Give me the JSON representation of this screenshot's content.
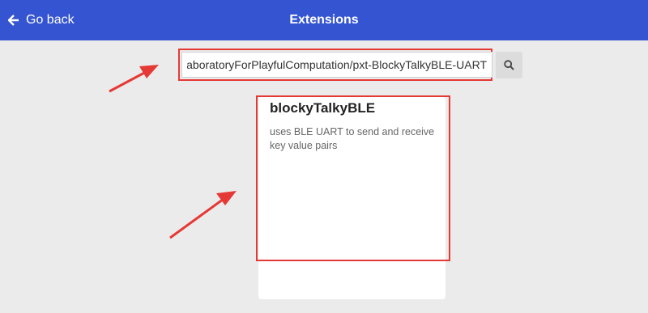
{
  "header": {
    "back_label": "Go back",
    "title": "Extensions",
    "background": "#3454d1"
  },
  "search": {
    "value": "https://github.com/LaboratoryForPlayfulComputation/pxt-BlockyTalkyBLE-UART",
    "icon": "search-icon"
  },
  "card": {
    "title": "blockyTalkyBLE",
    "description": "uses BLE UART to send and receive key value pairs"
  },
  "annotations": {
    "highlight_color": "#e53935"
  }
}
